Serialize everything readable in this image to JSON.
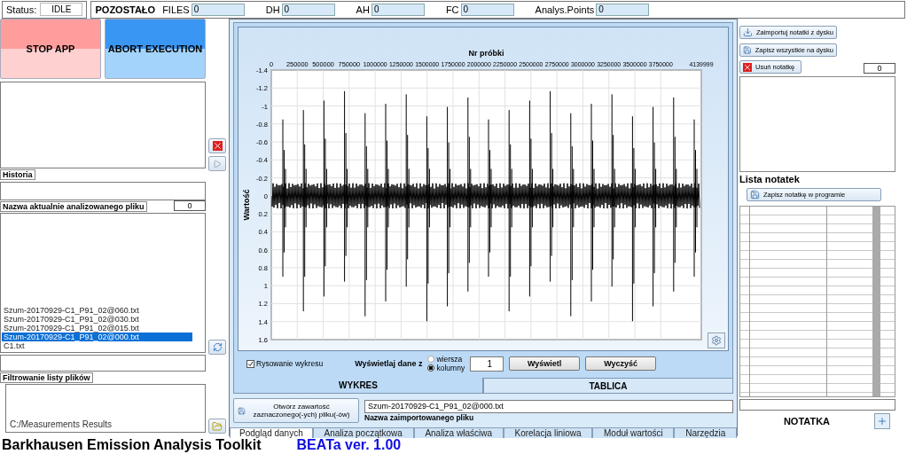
{
  "status_bar": {
    "status_label": "Status:",
    "status": "IDLE",
    "remaining_label": "POZOSTAŁO",
    "counters": [
      {
        "label": "FILES",
        "value": "0"
      },
      {
        "label": "DH",
        "value": "0"
      },
      {
        "label": "AH",
        "value": "0"
      },
      {
        "label": "FC",
        "value": "0"
      },
      {
        "label": "Analys.Points",
        "value": "0"
      }
    ]
  },
  "actions": {
    "stop": "STOP APP",
    "abort": "ABORT EXECUTION"
  },
  "left_panel": {
    "history_label": "Historia",
    "current_file_label": "Nazwa aktualnie analizowanego pliku",
    "file_count": "0",
    "files": [
      {
        "name": "Szum-20170929-C1_P91_02@060.txt",
        "selected": false
      },
      {
        "name": "Szum-20170929-C1_P91_02@030.txt",
        "selected": false
      },
      {
        "name": "Szum-20170929-C1_P91_02@015.txt",
        "selected": false
      },
      {
        "name": "Szum-20170929-C1_P91_02@000.txt",
        "selected": true
      },
      {
        "name": "C1.txt",
        "selected": false
      }
    ],
    "filter_label": "Filtrowanie listy plików",
    "path": "C:/Measurements Results"
  },
  "data_view": {
    "chart": {
      "x_title": "Nr próbki",
      "y_title": "Wartość",
      "x_ticks": [
        "0",
        "250000",
        "500000",
        "750000",
        "1000000",
        "1250000",
        "1500000",
        "1750000",
        "2000000",
        "2250000",
        "2500000",
        "2750000",
        "3000000",
        "3250000",
        "3500000",
        "3750000",
        "4139999"
      ],
      "y_ticks": [
        "-1.4",
        "-1.2",
        "-1",
        "-0.8",
        "-0.6",
        "-0.4",
        "-0.2",
        "0",
        "0.2",
        "0.4",
        "0.6",
        "0.8",
        "1",
        "1.2",
        "1.4",
        "1.6"
      ]
    },
    "draw_checkbox": {
      "label": "Rysowanie wykresu",
      "checked": true
    },
    "display_label": "Wyświetlaj dane z",
    "radios": [
      {
        "label": "wiersza",
        "selected": false
      },
      {
        "label": "kolumny",
        "selected": true
      }
    ],
    "spinner_value": "1",
    "buttons": [
      "Wyświetl",
      "Wyczyść"
    ],
    "sub_tabs": [
      {
        "label": "WYKRES",
        "selected": true
      },
      {
        "label": "TABLICA",
        "selected": false
      }
    ],
    "open_button": "Otwórz zawartość zaznaczonego(-ych) pliku(-ów)",
    "imported_file": "Szum-20170929-C1_P91_02@000.txt",
    "imported_label": "Nazwa zaimportowanego pliku"
  },
  "main_tabs": [
    {
      "label": "Podgląd danych",
      "selected": true
    },
    {
      "label": "Analiza początkowa",
      "selected": false
    },
    {
      "label": "Analiza właściwa",
      "selected": false
    },
    {
      "label": "Korelacja liniowa",
      "selected": false
    },
    {
      "label": "Moduł wartości",
      "selected": false
    },
    {
      "label": "Narzędzia",
      "selected": false
    }
  ],
  "notes": {
    "import_button": "Zaimportuj notatki z dysku",
    "save_all_button": "Zapisz wszystkie na dysku",
    "delete_button": "Usuń notatkę",
    "count": "0",
    "list_label": "Lista notatek",
    "save_button": "Zapisz notatkę w programie",
    "title": "NOTATKA"
  },
  "header": {
    "title": "Barkhausen Emission Analysis Toolkit",
    "version": "BEATa ver. 1.00"
  }
}
